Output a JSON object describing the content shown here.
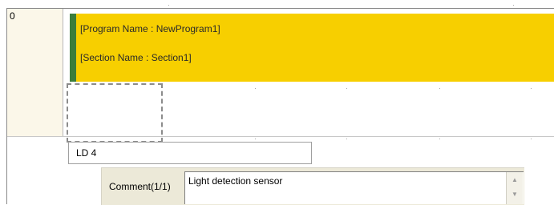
{
  "ladder": {
    "line_number": "0",
    "program_name": "[Program Name : NewProgram1]",
    "section_name": "[Section Name : Section1]"
  },
  "instruction_input": {
    "value": "LD 4"
  },
  "comment": {
    "label": "Comment(1/1)",
    "value": "Light detection sensor"
  },
  "icons": {
    "scroll_up": "scroll-up-arrow",
    "scroll_down": "scroll-down-arrow"
  },
  "colors": {
    "header_band": "#f7cf00",
    "section_marker": "#3b7d3b",
    "gutter": "#fbf7e9"
  }
}
